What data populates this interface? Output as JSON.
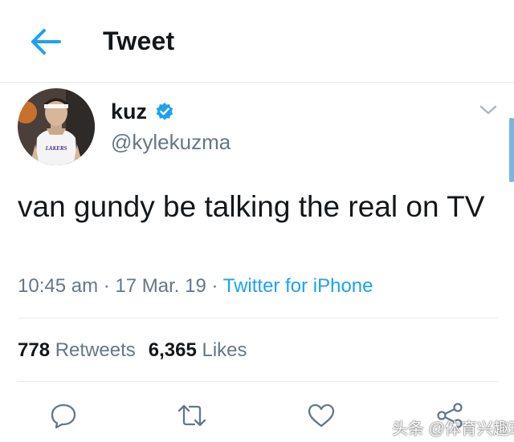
{
  "header": {
    "title": "Tweet",
    "back_icon": "arrow-left-icon"
  },
  "tweet": {
    "author": {
      "display_name": "kuz",
      "username": "@kylekuzma",
      "verified": true,
      "jersey_text": "LAKERS"
    },
    "text": "van gundy be talking the real on TV",
    "time": "10:45 am",
    "date": "17 Mar. 19",
    "separator": "·",
    "source": "Twitter for iPhone",
    "stats": {
      "retweets_count": "778",
      "retweets_label": "Retweets",
      "likes_count": "6,365",
      "likes_label": "Likes"
    }
  },
  "actions": [
    "reply-icon",
    "retweet-icon",
    "like-icon",
    "share-icon"
  ],
  "watermark": "头条 @体育兴趣班",
  "colors": {
    "accent": "#1da1f2",
    "text": "#14171a",
    "secondary": "#657786",
    "divider": "#e6ecf0"
  }
}
